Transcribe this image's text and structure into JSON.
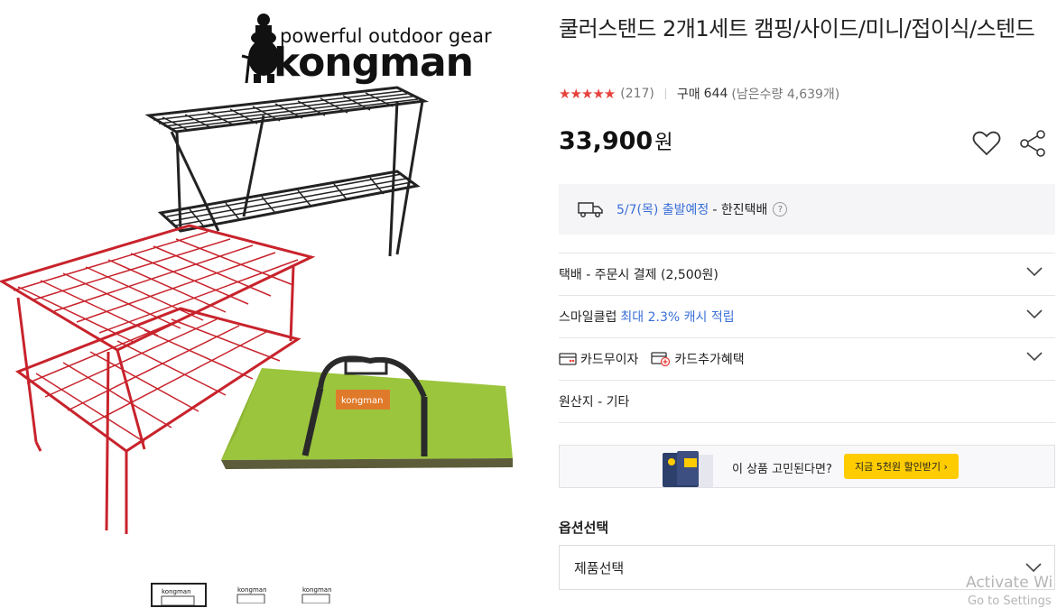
{
  "product": {
    "image_alt": "쿨러스탠드 제품 이미지",
    "brand_tagline": "powerful outdoor gear",
    "brand_name": "kongman",
    "bag_label": "kongman",
    "title": "쿨러스탠드 2개1세트 캠핑/사이드/미니/접이식/스텐드",
    "rating_stars": "★★★★★",
    "review_count": "(217)",
    "purchase_label": "구매",
    "purchase_count": "644",
    "stock_text": "(남은수량 4,639개)",
    "price": "33,900",
    "price_unit": "원"
  },
  "delivery": {
    "date_text": "5/7(목) 출발예정",
    "carrier_text": "- 한진택배",
    "help_icon_text": "?"
  },
  "rows": {
    "shipping": "택배 - 주문시 결제 (2,500원)",
    "smileclub_prefix": "스마일클럽",
    "smileclub_benefit": "최대 2.3% 캐시 적립",
    "card_nointerest": "카드무이자",
    "card_extra": "카드추가혜택",
    "origin": "원산지 - 기타"
  },
  "banner": {
    "question": "이 상품 고민된다면?",
    "cta": "지금 5천원 할인받기 ›"
  },
  "options": {
    "title": "옵션선택",
    "select_value": "제품선택"
  },
  "thumbnails": [
    "thumb-1",
    "thumb-2",
    "thumb-3"
  ],
  "os_overlay": {
    "line1": "Activate Wi",
    "line2": "Go to Settings"
  },
  "colors": {
    "star": "#e8423c",
    "accent_blue": "#3a6fd8",
    "cta_yellow": "#ffcc00",
    "bag_green": "#9bc53d",
    "rack_red": "#c8232c",
    "rack_black": "#222222"
  }
}
